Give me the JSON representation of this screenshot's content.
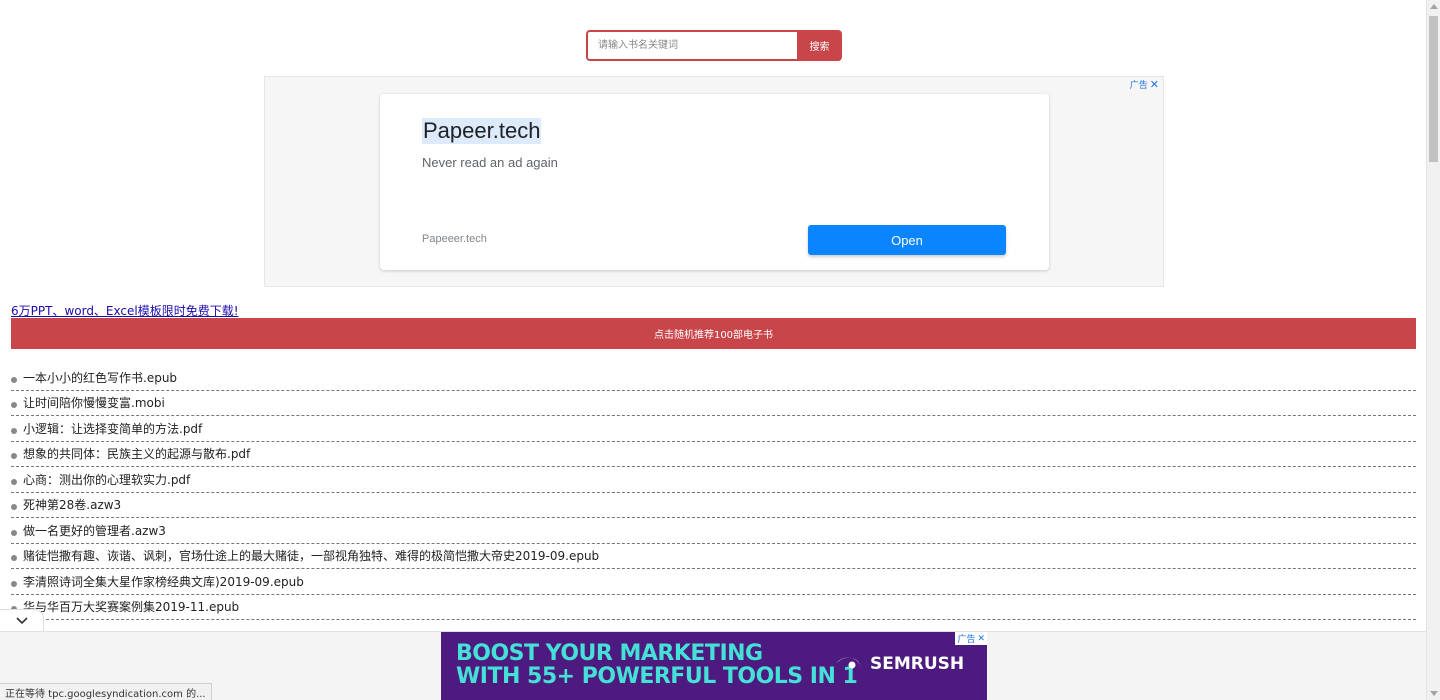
{
  "search": {
    "placeholder": "请输入书名关键词",
    "button_label": "搜索"
  },
  "top_ad": {
    "choices_label": "广告",
    "close_symbol": "✕",
    "title": "Papeer.tech",
    "subtitle": "Never read an ad again",
    "domain": "Papeeer.tech",
    "open_label": "Open",
    "button_color": "#0a84ff"
  },
  "promo": {
    "link_text": "6万PPT、word、Excel模板限时免费下载!",
    "random_bar_label": "点击随机推荐100部电子书",
    "accent_color": "#c8454a"
  },
  "books": [
    "一本小小的红色写作书.epub",
    "让时间陪你慢慢变富.mobi",
    "小逻辑：让选择变简单的方法.pdf",
    "想象的共同体：民族主义的起源与散布.pdf",
    "心商：测出你的心理软实力.pdf",
    "死神第28卷.azw3",
    "做一名更好的管理者.azw3",
    "赌徒恺撒有趣、诙谐、讽刺，官场仕途上的最大赌徒，一部视角独特、难得的极简恺撒大帝史2019-09.epub",
    "李清照诗词全集大星作家榜经典文库)2019-09.epub",
    "华与华百万大奖赛案例集2019-11.epub"
  ],
  "bottom_ad": {
    "headline_line1": "BOOST YOUR MARKETING",
    "headline_line2": "WITH 55+ POWERFUL TOOLS IN 1",
    "brand": "SEMRUSH",
    "choices_label": "广告",
    "close_symbol": "✕",
    "background_color": "#4d1a7f",
    "headline_color": "#45e0d6"
  },
  "collapse_icon": "chevron-down-icon",
  "status_bar": {
    "text": "正在等待 tpc.googlesyndication.com 的..."
  }
}
